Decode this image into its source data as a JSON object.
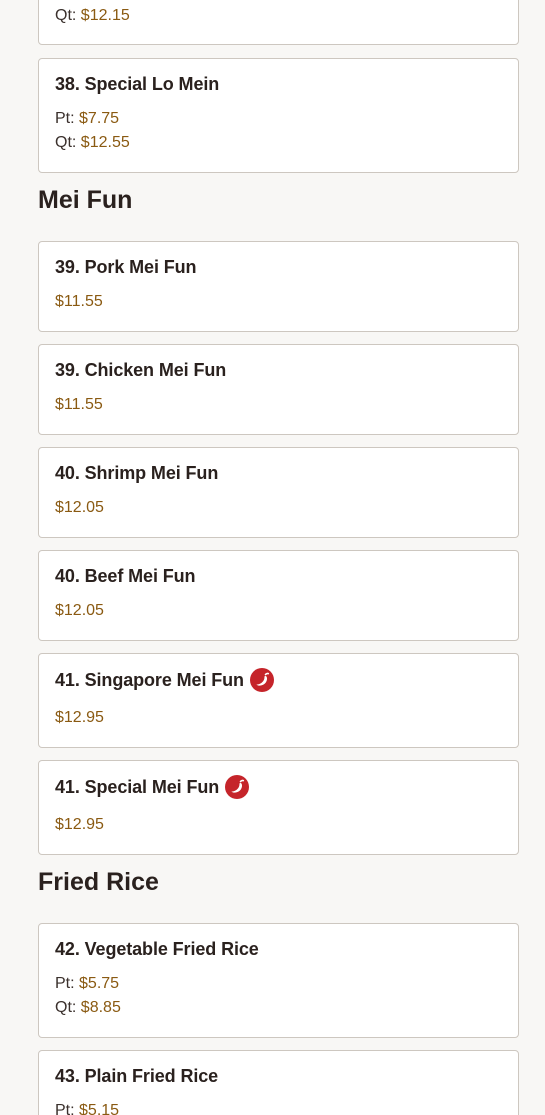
{
  "menu": {
    "cards": {
      "top_partial": {
        "prices": [
          {
            "size": "Qt:",
            "amount": "$12.15"
          }
        ]
      },
      "special_lo_mein": {
        "name": "38. Special Lo Mein",
        "prices": [
          {
            "size": "Pt:",
            "amount": "$7.75"
          },
          {
            "size": "Qt:",
            "amount": "$12.55"
          }
        ]
      }
    },
    "sections": {
      "mei_fun": {
        "title": "Mei Fun",
        "items": [
          {
            "name": "39. Pork Mei Fun",
            "price": "$11.55",
            "spicy": false
          },
          {
            "name": "39. Chicken Mei Fun",
            "price": "$11.55",
            "spicy": false
          },
          {
            "name": "40. Shrimp Mei Fun",
            "price": "$12.05",
            "spicy": false
          },
          {
            "name": "40. Beef Mei Fun",
            "price": "$12.05",
            "spicy": false
          },
          {
            "name": "41. Singapore Mei Fun",
            "price": "$12.95",
            "spicy": true
          },
          {
            "name": "41. Special Mei Fun",
            "price": "$12.95",
            "spicy": true
          }
        ]
      },
      "fried_rice": {
        "title": "Fried Rice",
        "items": [
          {
            "name": "42. Vegetable Fried Rice",
            "prices": [
              {
                "size": "Pt:",
                "amount": "$5.75"
              },
              {
                "size": "Qt:",
                "amount": "$8.85"
              }
            ]
          },
          {
            "name": "43. Plain Fried Rice",
            "prices": [
              {
                "size": "Pt:",
                "amount": "$5.15"
              }
            ]
          }
        ]
      }
    }
  },
  "icons": {
    "spicy": "chili-pepper-icon"
  },
  "colors": {
    "background": "#f8f7f5",
    "card_background": "#ffffff",
    "card_border": "#cdc7c0",
    "price": "#8a5a12",
    "text": "#2a211e",
    "spicy_badge": "#c5242a"
  }
}
